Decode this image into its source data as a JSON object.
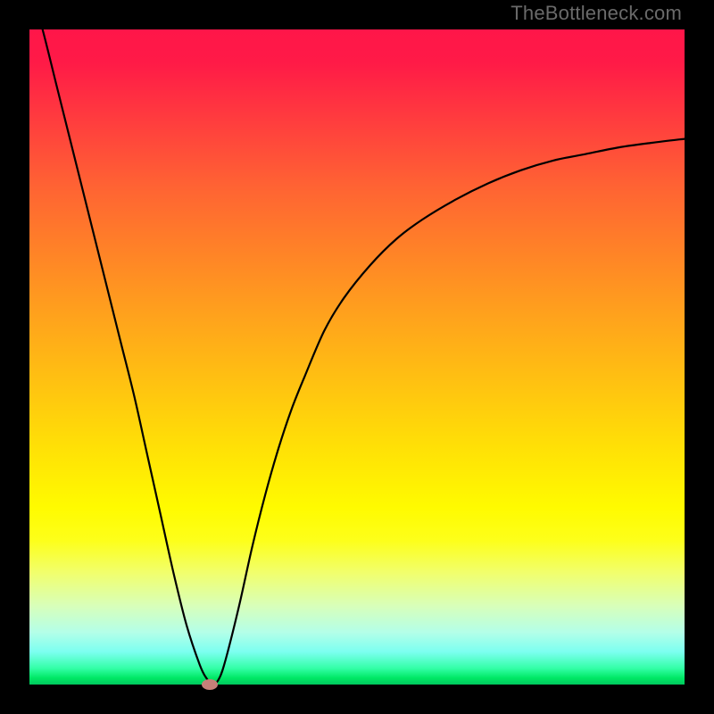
{
  "watermark": "TheBottleneck.com",
  "chart_data": {
    "type": "line",
    "title": "",
    "xlabel": "",
    "ylabel": "",
    "xlim": [
      0,
      100
    ],
    "ylim": [
      0,
      100
    ],
    "grid": false,
    "background": "rainbow-gradient-vertical",
    "background_stops": [
      {
        "pos": 0,
        "color": "#ff1649"
      },
      {
        "pos": 50,
        "color": "#ffb314"
      },
      {
        "pos": 75,
        "color": "#fffb00"
      },
      {
        "pos": 100,
        "color": "#00c85e"
      }
    ],
    "series": [
      {
        "name": "bottleneck-curve",
        "color": "#000000",
        "x": [
          0,
          2,
          4,
          6,
          8,
          10,
          12,
          14,
          16,
          18,
          20,
          22,
          24,
          26,
          27,
          28,
          29,
          30,
          32,
          34,
          36,
          38,
          40,
          42,
          45,
          48,
          52,
          56,
          60,
          65,
          70,
          75,
          80,
          85,
          90,
          95,
          100
        ],
        "values": [
          107,
          100,
          92,
          84,
          76,
          68,
          60,
          52,
          44,
          35,
          26,
          17,
          9,
          3,
          1,
          0,
          1,
          4,
          12,
          21,
          29,
          36,
          42,
          47,
          54,
          59,
          64,
          68,
          71,
          74,
          76.5,
          78.5,
          80,
          81,
          82,
          82.7,
          83.3
        ]
      }
    ],
    "marker": {
      "x": 27.5,
      "y": 0,
      "color": "#c68079",
      "shape": "ellipse"
    },
    "frame_color": "#000000",
    "frame_thickness_px": 33
  }
}
